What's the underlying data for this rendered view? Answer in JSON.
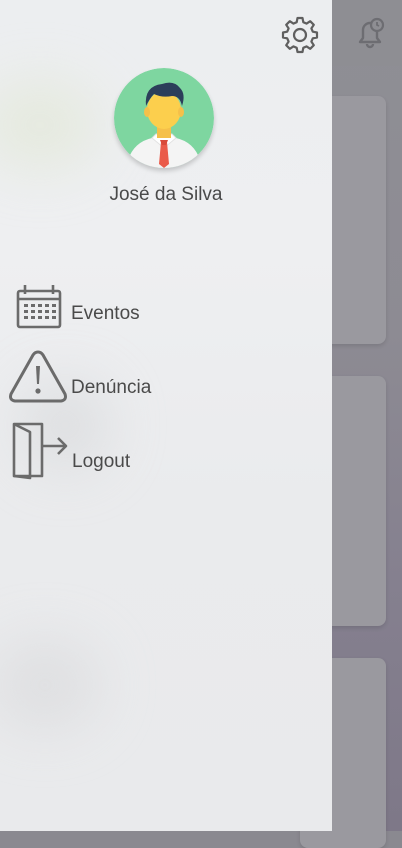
{
  "user": {
    "name": "José da Silva"
  },
  "menu": [
    {
      "label": "Eventos",
      "icon": "calendar-icon"
    },
    {
      "label": "Denúncia",
      "icon": "warning-icon"
    },
    {
      "label": "Logout",
      "icon": "logout-icon"
    }
  ],
  "colors": {
    "drawer_bg": "#eceef0",
    "icon_gray": "#6b6b6b",
    "text": "#4a4a4a",
    "avatar_bg": "#7ed6a0",
    "overlay": "#8e8e93"
  }
}
